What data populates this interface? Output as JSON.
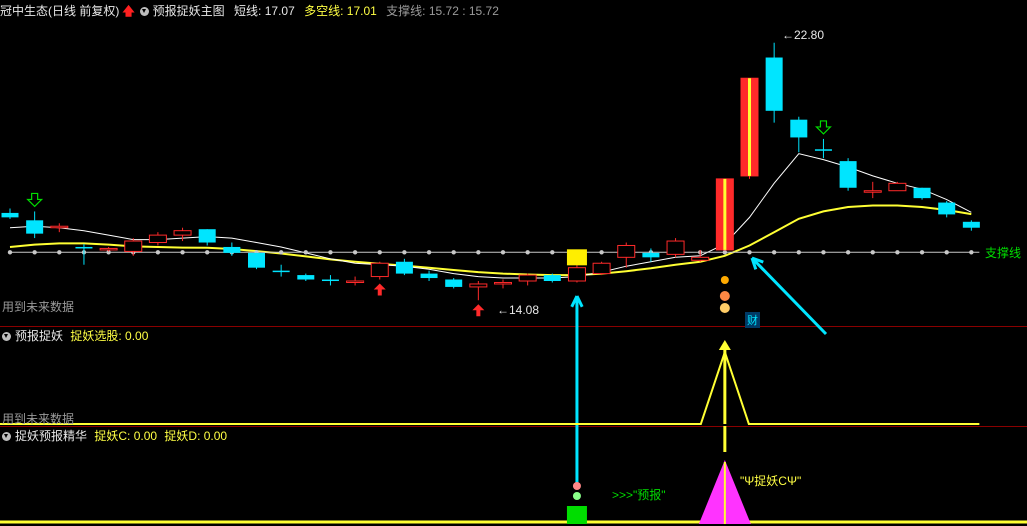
{
  "panel_main": {
    "title": "冠中生态(日线 前复权)",
    "indicator": "预报捉妖主图",
    "items": [
      {
        "label": "短线",
        "value": "17.07"
      },
      {
        "label": "多空线",
        "value": "17.01"
      },
      {
        "label": "支撑线",
        "value": "15.72 : 15.72"
      }
    ],
    "future_note": "用到未来数据",
    "support_label": "支撑线",
    "high_label": "22.80",
    "low_label": "14.08",
    "cai_label": "财"
  },
  "panel_mid": {
    "title": "预报捉妖",
    "item_label": "捉妖选股",
    "item_value": "0.00",
    "future_note": "用到未来数据"
  },
  "panel_bottom": {
    "title": "捉妖预报精华",
    "items": [
      {
        "label": "捉妖C",
        "value": "0.00"
      },
      {
        "label": "捉妖D",
        "value": "0.00"
      }
    ],
    "forecast_label": ">>>\"预报\"",
    "catch_label": "\"Ψ捉妖CΨ\""
  },
  "colors": {
    "up": "#ff2a2a",
    "down": "#00e5ff",
    "short_line": "#ffffff",
    "bull_bear_line": "#ffff33",
    "support_line": "#c8c8c8",
    "arrow": "#00e5ff",
    "signal_green": "#00dd00",
    "signal_magenta": "#ff33ff"
  },
  "chart_data": {
    "type": "candlestick",
    "title": "冠中生态(日线 前复权)",
    "ylim": [
      13.5,
      23.5
    ],
    "candles": [
      {
        "o": 17.05,
        "h": 17.2,
        "l": 16.85,
        "c": 16.9
      },
      {
        "o": 16.8,
        "h": 17.1,
        "l": 16.2,
        "c": 16.35
      },
      {
        "o": 16.55,
        "h": 16.7,
        "l": 16.4,
        "c": 16.6
      },
      {
        "o": 15.9,
        "h": 16.0,
        "l": 15.3,
        "c": 15.85
      },
      {
        "o": 15.8,
        "h": 15.9,
        "l": 15.75,
        "c": 15.85
      },
      {
        "o": 15.75,
        "h": 16.2,
        "l": 15.6,
        "c": 16.1
      },
      {
        "o": 16.05,
        "h": 16.4,
        "l": 15.95,
        "c": 16.3
      },
      {
        "o": 16.3,
        "h": 16.55,
        "l": 16.1,
        "c": 16.45
      },
      {
        "o": 16.5,
        "h": 16.5,
        "l": 15.95,
        "c": 16.05
      },
      {
        "o": 15.9,
        "h": 16.05,
        "l": 15.6,
        "c": 15.7
      },
      {
        "o": 15.7,
        "h": 15.7,
        "l": 15.15,
        "c": 15.2
      },
      {
        "o": 15.1,
        "h": 15.3,
        "l": 14.9,
        "c": 15.05
      },
      {
        "o": 14.95,
        "h": 15.0,
        "l": 14.75,
        "c": 14.8
      },
      {
        "o": 14.8,
        "h": 14.95,
        "l": 14.6,
        "c": 14.75
      },
      {
        "o": 14.7,
        "h": 14.9,
        "l": 14.6,
        "c": 14.75
      },
      {
        "o": 14.9,
        "h": 15.4,
        "l": 14.8,
        "c": 15.35
      },
      {
        "o": 15.4,
        "h": 15.5,
        "l": 14.95,
        "c": 15.0
      },
      {
        "o": 15.0,
        "h": 15.1,
        "l": 14.75,
        "c": 14.85
      },
      {
        "o": 14.8,
        "h": 14.85,
        "l": 14.5,
        "c": 14.55
      },
      {
        "o": 14.55,
        "h": 14.75,
        "l": 14.1,
        "c": 14.65
      },
      {
        "o": 14.7,
        "h": 14.8,
        "l": 14.5,
        "c": 14.7
      },
      {
        "o": 14.75,
        "h": 15.0,
        "l": 14.6,
        "c": 14.95
      },
      {
        "o": 14.95,
        "h": 15.0,
        "l": 14.7,
        "c": 14.75
      },
      {
        "o": 14.75,
        "h": 15.3,
        "l": 14.7,
        "c": 15.2
      },
      {
        "o": 15.0,
        "h": 15.4,
        "l": 14.95,
        "c": 15.35
      },
      {
        "o": 15.55,
        "h": 16.05,
        "l": 15.2,
        "c": 15.95
      },
      {
        "o": 15.7,
        "h": 15.85,
        "l": 15.4,
        "c": 15.55
      },
      {
        "o": 15.65,
        "h": 16.2,
        "l": 15.55,
        "c": 16.1
      },
      {
        "o": 15.45,
        "h": 15.8,
        "l": 15.4,
        "c": 15.55
      },
      {
        "o": 15.8,
        "h": 18.2,
        "l": 15.8,
        "c": 18.2
      },
      {
        "o": 18.3,
        "h": 21.6,
        "l": 18.2,
        "c": 21.6
      },
      {
        "o": 22.3,
        "h": 22.8,
        "l": 20.1,
        "c": 20.5
      },
      {
        "o": 20.2,
        "h": 20.3,
        "l": 19.1,
        "c": 19.6
      },
      {
        "o": 19.2,
        "h": 19.55,
        "l": 18.9,
        "c": 19.15
      },
      {
        "o": 18.8,
        "h": 18.9,
        "l": 17.8,
        "c": 17.9
      },
      {
        "o": 17.75,
        "h": 18.1,
        "l": 17.55,
        "c": 17.8
      },
      {
        "o": 17.8,
        "h": 18.1,
        "l": 17.8,
        "c": 18.05
      },
      {
        "o": 17.9,
        "h": 17.9,
        "l": 17.5,
        "c": 17.55
      },
      {
        "o": 17.4,
        "h": 17.45,
        "l": 16.9,
        "c": 17.0
      },
      {
        "o": 16.75,
        "h": 16.8,
        "l": 16.45,
        "c": 16.55
      }
    ],
    "short_line": [
      16.55,
      16.6,
      16.55,
      16.45,
      16.3,
      16.15,
      16.15,
      16.2,
      16.25,
      16.2,
      16.05,
      15.9,
      15.7,
      15.5,
      15.35,
      15.3,
      15.25,
      15.15,
      15.0,
      14.9,
      14.85,
      14.85,
      14.85,
      14.9,
      15.05,
      15.25,
      15.4,
      15.55,
      15.6,
      16.0,
      16.9,
      18.05,
      19.05,
      18.85,
      18.6,
      18.3,
      18.05,
      17.85,
      17.5,
      17.07
    ],
    "bull_bear_line": [
      15.9,
      15.98,
      16.02,
      16.02,
      15.98,
      15.92,
      15.9,
      15.88,
      15.87,
      15.83,
      15.76,
      15.68,
      15.58,
      15.48,
      15.4,
      15.33,
      15.27,
      15.2,
      15.12,
      15.05,
      15.0,
      14.97,
      14.95,
      14.95,
      15.0,
      15.08,
      15.18,
      15.3,
      15.4,
      15.6,
      15.95,
      16.4,
      16.85,
      17.1,
      17.25,
      17.3,
      17.3,
      17.25,
      17.15,
      17.01
    ],
    "support_level": 15.72,
    "up_arrows": [
      15,
      19
    ],
    "down_arrows": [
      1,
      33
    ],
    "forecast_index": 23,
    "catch_index": 29
  }
}
